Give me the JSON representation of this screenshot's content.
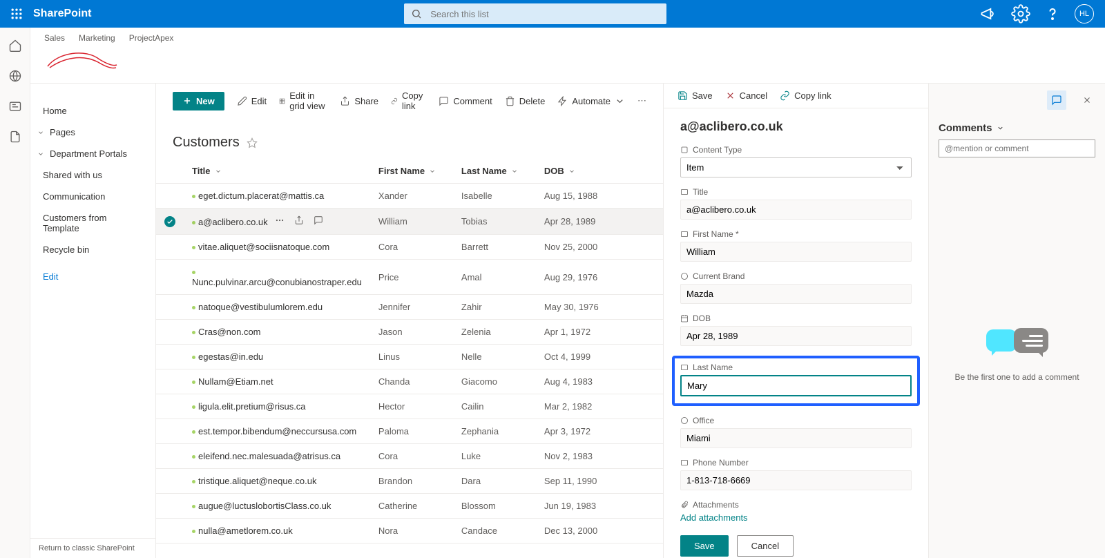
{
  "suite": {
    "app_name": "SharePoint",
    "search_placeholder": "Search this list",
    "avatar_initials": "HL"
  },
  "site": {
    "nav": [
      "Sales",
      "Marketing",
      "ProjectApex"
    ]
  },
  "left_nav": {
    "home": "Home",
    "pages": "Pages",
    "dept": "Department Portals",
    "shared": "Shared with us",
    "comm": "Communication",
    "cust_tmpl": "Customers from Template",
    "recycle": "Recycle bin",
    "edit": "Edit",
    "return": "Return to classic SharePoint"
  },
  "cmdbar": {
    "new": "New",
    "edit": "Edit",
    "grid": "Edit in grid view",
    "share": "Share",
    "copylink": "Copy link",
    "comment": "Comment",
    "delete": "Delete",
    "automate": "Automate"
  },
  "list": {
    "title": "Customers",
    "cols": {
      "title": "Title",
      "first": "First Name",
      "last": "Last Name",
      "dob": "DOB"
    },
    "rows": [
      {
        "title": "eget.dictum.placerat@mattis.ca",
        "first": "Xander",
        "last": "Isabelle",
        "dob": "Aug 15, 1988"
      },
      {
        "title": "a@aclibero.co.uk",
        "first": "William",
        "last": "Tobias",
        "dob": "Apr 28, 1989",
        "selected": true
      },
      {
        "title": "vitae.aliquet@sociisnatoque.com",
        "first": "Cora",
        "last": "Barrett",
        "dob": "Nov 25, 2000"
      },
      {
        "title": "Nunc.pulvinar.arcu@conubianostraper.edu",
        "first": "Price",
        "last": "Amal",
        "dob": "Aug 29, 1976"
      },
      {
        "title": "natoque@vestibulumlorem.edu",
        "first": "Jennifer",
        "last": "Zahir",
        "dob": "May 30, 1976"
      },
      {
        "title": "Cras@non.com",
        "first": "Jason",
        "last": "Zelenia",
        "dob": "Apr 1, 1972"
      },
      {
        "title": "egestas@in.edu",
        "first": "Linus",
        "last": "Nelle",
        "dob": "Oct 4, 1999"
      },
      {
        "title": "Nullam@Etiam.net",
        "first": "Chanda",
        "last": "Giacomo",
        "dob": "Aug 4, 1983"
      },
      {
        "title": "ligula.elit.pretium@risus.ca",
        "first": "Hector",
        "last": "Cailin",
        "dob": "Mar 2, 1982"
      },
      {
        "title": "est.tempor.bibendum@neccursusa.com",
        "first": "Paloma",
        "last": "Zephania",
        "dob": "Apr 3, 1972"
      },
      {
        "title": "eleifend.nec.malesuada@atrisus.ca",
        "first": "Cora",
        "last": "Luke",
        "dob": "Nov 2, 1983"
      },
      {
        "title": "tristique.aliquet@neque.co.uk",
        "first": "Brandon",
        "last": "Dara",
        "dob": "Sep 11, 1990"
      },
      {
        "title": "augue@luctuslobortisClass.co.uk",
        "first": "Catherine",
        "last": "Blossom",
        "dob": "Jun 19, 1983"
      },
      {
        "title": "nulla@ametlorem.co.uk",
        "first": "Nora",
        "last": "Candace",
        "dob": "Dec 13, 2000"
      }
    ]
  },
  "panel": {
    "save": "Save",
    "cancel": "Cancel",
    "copylink": "Copy link",
    "heading": "a@aclibero.co.uk",
    "labels": {
      "content_type": "Content Type",
      "title": "Title",
      "first": "First Name *",
      "brand": "Current Brand",
      "dob": "DOB",
      "last": "Last Name",
      "office": "Office",
      "phone": "Phone Number",
      "attachments": "Attachments",
      "add_attach": "Add attachments"
    },
    "values": {
      "content_type": "Item",
      "title": "a@aclibero.co.uk",
      "first": "William",
      "brand": "Mazda",
      "dob": "Apr 28, 1989",
      "last": "Mary",
      "office": "Miami",
      "phone": "1-813-718-6669"
    },
    "btn_save": "Save",
    "btn_cancel": "Cancel"
  },
  "comments": {
    "title": "Comments",
    "placeholder": "@mention or comment",
    "empty": "Be the first one to add a comment"
  }
}
